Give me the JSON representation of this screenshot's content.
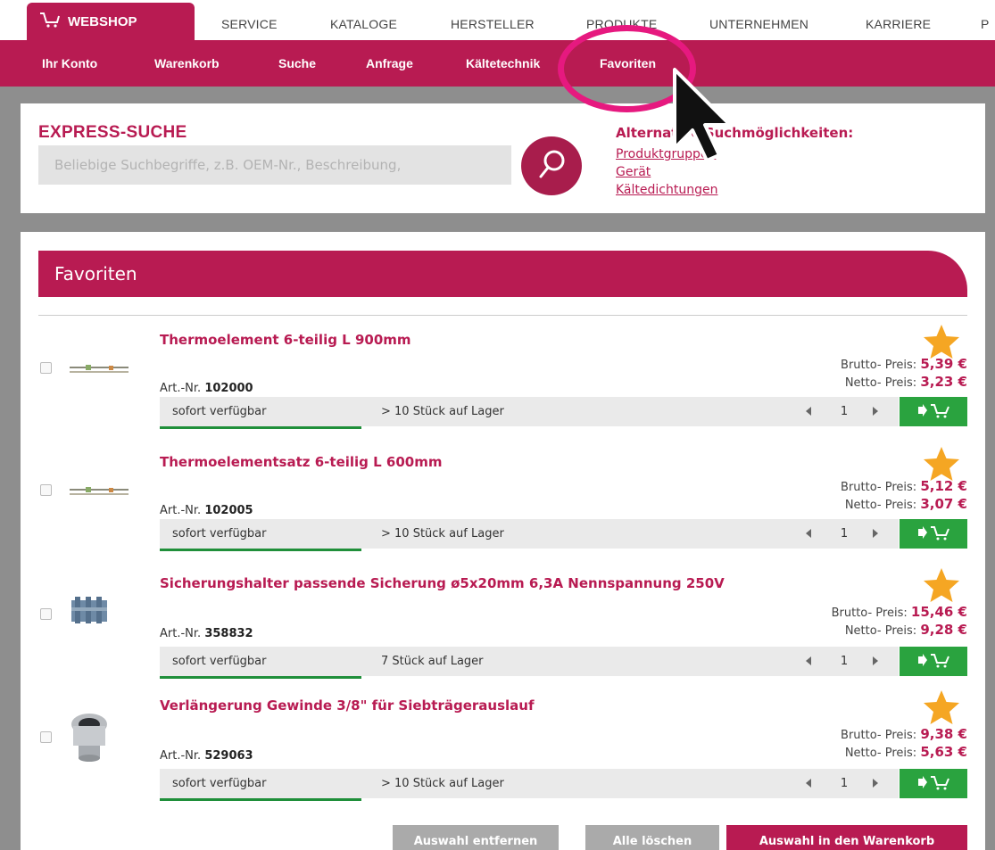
{
  "topnav": {
    "webshop": "WEBSHOP",
    "links": [
      "SERVICE",
      "KATALOGE",
      "HERSTELLER",
      "PRODUKTE",
      "UNTERNEHMEN",
      "KARRIERE",
      "P"
    ]
  },
  "subnav": {
    "links": [
      "Ihr Konto",
      "Warenkorb",
      "Suche",
      "Anfrage",
      "Kältetechnik",
      "Favoriten"
    ]
  },
  "express": {
    "title": "EXPRESS-SUCHE",
    "placeholder": "Beliebige Suchbegriffe, z.B. OEM-Nr., Beschreibung,",
    "alt_title": "Alternative Suchmöglichkeiten:",
    "alt_links": [
      "Produktgruppen",
      "Gerät",
      "Kältedichtungen"
    ]
  },
  "favorites": {
    "title": "Favoriten",
    "brutto_label": "Brutto- Preis:",
    "netto_label": "Netto- Preis:",
    "art_label": "Art.-Nr.",
    "items": [
      {
        "title": "Thermoelement 6-teilig L 900mm",
        "art": "102000",
        "brutto": "5,39 €",
        "netto": "3,23 €",
        "availability": "sofort verfügbar",
        "stock": "> 10 Stück auf Lager",
        "qty": "1"
      },
      {
        "title": "Thermoelementsatz 6-teilig L 600mm",
        "art": "102005",
        "brutto": "5,12 €",
        "netto": "3,07 €",
        "availability": "sofort verfügbar",
        "stock": "> 10 Stück auf Lager",
        "qty": "1"
      },
      {
        "title": "Sicherungshalter passende Sicherung ø5x20mm 6,3A Nennspannung 250V",
        "art": "358832",
        "brutto": "15,46 €",
        "netto": "9,28 €",
        "availability": "sofort verfügbar",
        "stock": "7 Stück auf Lager",
        "qty": "1"
      },
      {
        "title": "Verlängerung Gewinde 3/8\" für Siebträgerauslauf",
        "art": "529063",
        "brutto": "9,38 €",
        "netto": "5,63 €",
        "availability": "sofort verfügbar",
        "stock": "> 10 Stück auf Lager",
        "qty": "1"
      }
    ]
  },
  "actions": {
    "remove": "Auswahl entfernen",
    "delete_all": "Alle löschen",
    "to_cart": "Auswahl in den Warenkorb"
  },
  "colors": {
    "brand": "#b81b52",
    "green": "#2aa33f",
    "star": "#f5a623",
    "highlight_ring": "#e6197f"
  }
}
